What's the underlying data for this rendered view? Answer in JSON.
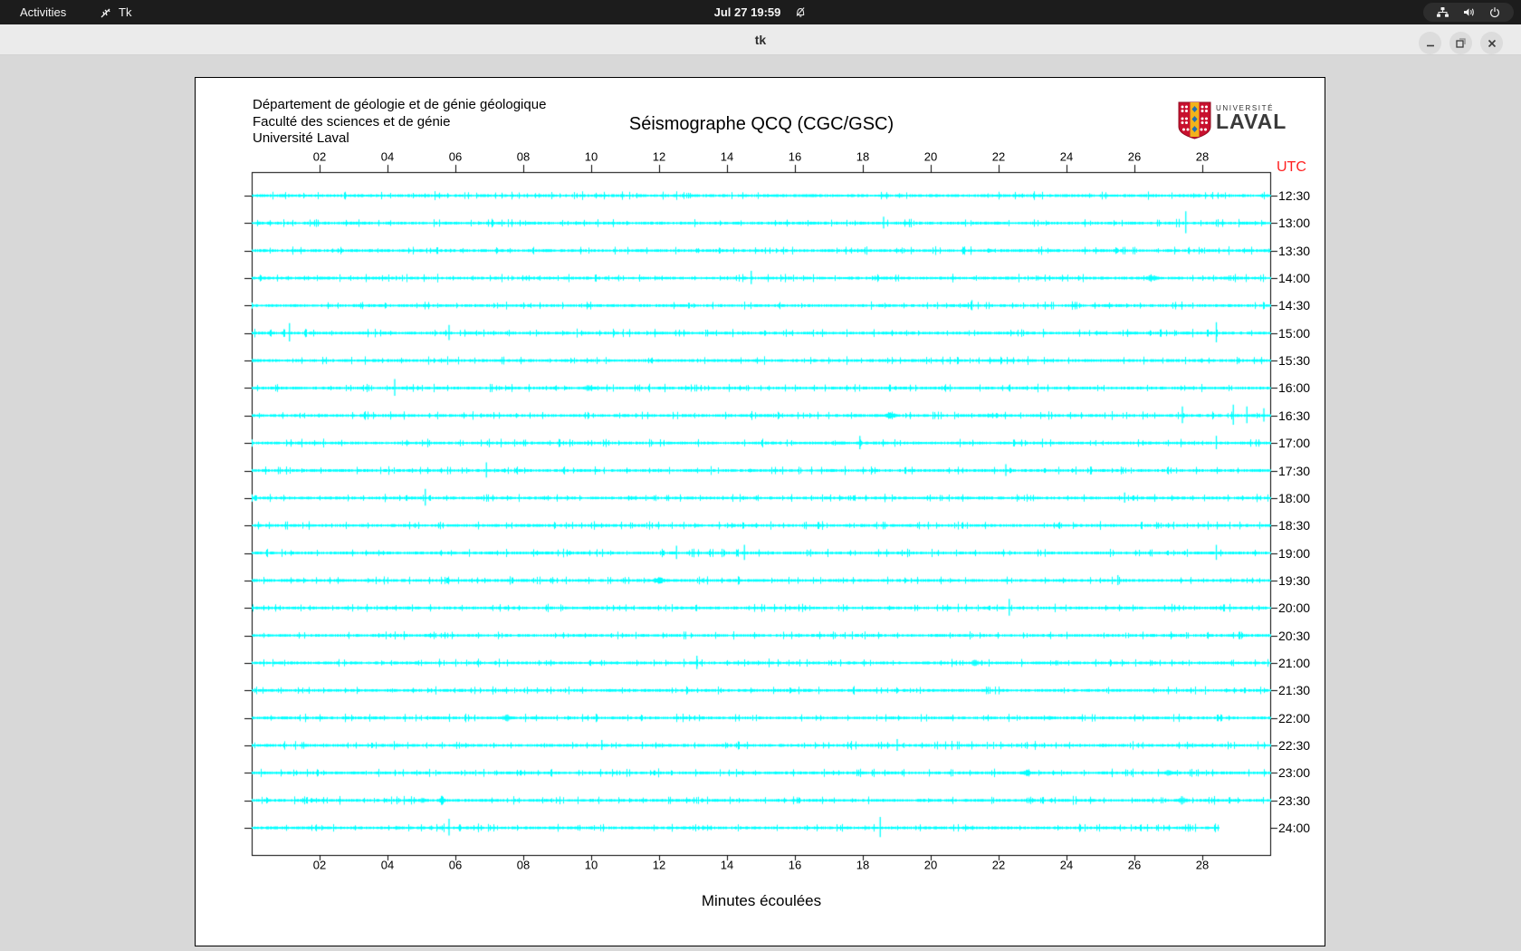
{
  "top_bar": {
    "activities_label": "Activities",
    "app_name": "Tk",
    "clock": "Jul 27 19:59",
    "tray_icons": [
      "network",
      "volume",
      "power"
    ],
    "notification_state_icon": "bell-slash"
  },
  "window": {
    "title": "tk",
    "controls": [
      "minimize",
      "maximize",
      "close"
    ]
  },
  "seismograph": {
    "header_lines": [
      "Département de géologie et de génie géologique",
      "Faculté des sciences et de génie",
      "Université Laval"
    ],
    "title": "Séismographe QCQ (CGC/GSC)",
    "logo": {
      "line1": "UNIVERSITÉ",
      "line2": "LAVAL"
    },
    "utc_label": "UTC",
    "x_axis_label": "Minutes écoulées",
    "trace_color": "#00ffff",
    "utc_color": "#ff1f1f"
  },
  "chart_data": {
    "type": "line",
    "title": "Séismographe QCQ (CGC/GSC)",
    "xlabel": "Minutes écoulées",
    "x_range_minutes": [
      0,
      30
    ],
    "x_ticks": [
      "02",
      "04",
      "06",
      "08",
      "10",
      "12",
      "14",
      "16",
      "18",
      "20",
      "22",
      "24",
      "26",
      "28"
    ],
    "rows": [
      {
        "utc": "12:30",
        "events": []
      },
      {
        "utc": "13:00",
        "events": [
          {
            "m": 18.6,
            "a": 7
          },
          {
            "m": 27.5,
            "a": 13
          }
        ]
      },
      {
        "utc": "13:30",
        "events": []
      },
      {
        "utc": "14:00",
        "events": [
          {
            "m": 14.7,
            "a": 8
          },
          {
            "m": 26.5,
            "a": 4,
            "w": 18
          }
        ]
      },
      {
        "utc": "14:30",
        "events": [
          {
            "m": 9.9,
            "a": 3,
            "w": 10
          },
          {
            "m": 21.2,
            "a": 6
          }
        ]
      },
      {
        "utc": "15:00",
        "events": [
          {
            "m": 1.1,
            "a": 11
          },
          {
            "m": 5.8,
            "a": 9
          },
          {
            "m": 28.4,
            "a": 12
          }
        ]
      },
      {
        "utc": "15:30",
        "events": []
      },
      {
        "utc": "16:00",
        "events": [
          {
            "m": 4.2,
            "a": 10
          },
          {
            "m": 9.9,
            "a": 4,
            "w": 14
          }
        ]
      },
      {
        "utc": "16:30",
        "events": [
          {
            "m": 18.8,
            "a": 5,
            "w": 16
          },
          {
            "m": 27.4,
            "a": 10
          },
          {
            "m": 28.9,
            "a": 12
          },
          {
            "m": 29.3,
            "a": 10
          },
          {
            "m": 29.8,
            "a": 8
          }
        ]
      },
      {
        "utc": "17:00",
        "events": [
          {
            "m": 17.9,
            "a": 8
          },
          {
            "m": 28.4,
            "a": 8
          }
        ]
      },
      {
        "utc": "17:30",
        "events": [
          {
            "m": 6.9,
            "a": 9
          },
          {
            "m": 22.2,
            "a": 7
          }
        ]
      },
      {
        "utc": "18:00",
        "events": [
          {
            "m": 5.1,
            "a": 10
          },
          {
            "m": 25.7,
            "a": 6
          }
        ]
      },
      {
        "utc": "18:30",
        "events": []
      },
      {
        "utc": "19:00",
        "events": [
          {
            "m": 12.5,
            "a": 8
          },
          {
            "m": 14.5,
            "a": 9
          },
          {
            "m": 28.4,
            "a": 9
          }
        ]
      },
      {
        "utc": "19:30",
        "events": [
          {
            "m": 12.0,
            "a": 4,
            "w": 16
          },
          {
            "m": 25.5,
            "a": 6
          }
        ]
      },
      {
        "utc": "20:00",
        "events": [
          {
            "m": 22.3,
            "a": 10
          }
        ]
      },
      {
        "utc": "20:30",
        "events": []
      },
      {
        "utc": "21:00",
        "events": [
          {
            "m": 13.1,
            "a": 8
          },
          {
            "m": 21.3,
            "a": 4,
            "w": 14
          }
        ]
      },
      {
        "utc": "21:30",
        "events": []
      },
      {
        "utc": "22:00",
        "events": [
          {
            "m": 7.5,
            "a": 4,
            "w": 18
          },
          {
            "m": 23.5,
            "a": 3,
            "w": 12
          }
        ]
      },
      {
        "utc": "22:30",
        "events": [
          {
            "m": 10.3,
            "a": 6
          },
          {
            "m": 19.0,
            "a": 7
          }
        ]
      },
      {
        "utc": "23:00",
        "events": [
          {
            "m": 22.8,
            "a": 4,
            "w": 14
          },
          {
            "m": 27.0,
            "a": 4,
            "w": 12
          }
        ]
      },
      {
        "utc": "23:30",
        "events": [
          {
            "m": 5.0,
            "a": 4,
            "w": 10
          },
          {
            "m": 5.6,
            "a": 5,
            "w": 8
          },
          {
            "m": 27.4,
            "a": 5,
            "w": 14
          }
        ]
      },
      {
        "utc": "24:00",
        "events": [
          {
            "m": 5.8,
            "a": 10
          },
          {
            "m": 18.5,
            "a": 12
          }
        ],
        "end_m": 28.5
      }
    ]
  }
}
